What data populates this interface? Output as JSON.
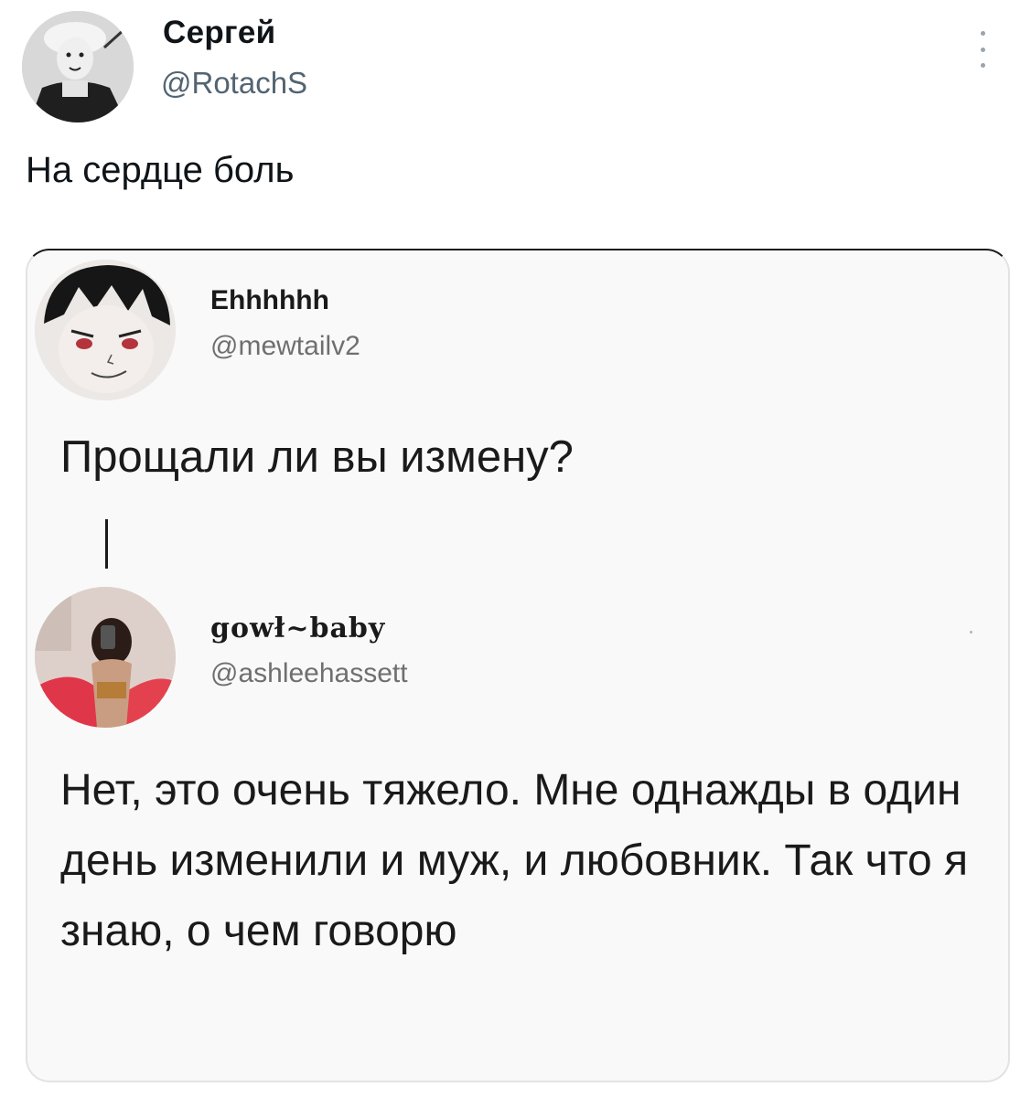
{
  "tweet": {
    "author_name": "Сергей",
    "author_handle": "@RotachS",
    "text": "На сердце боль",
    "more_icon": "more-vertical-icon"
  },
  "quoted": {
    "original": {
      "author_name": "Ehhhhhh",
      "author_handle": "@mewtailv2",
      "text": "Прощали ли вы измену?"
    },
    "reply": {
      "author_name": "gowł~baby",
      "author_handle": "@ashleehassett",
      "text": "Нет, это очень тяжело. Мне однажды в один день изменили и муж, и любовник. Так что я знаю, о чем говорю"
    }
  }
}
